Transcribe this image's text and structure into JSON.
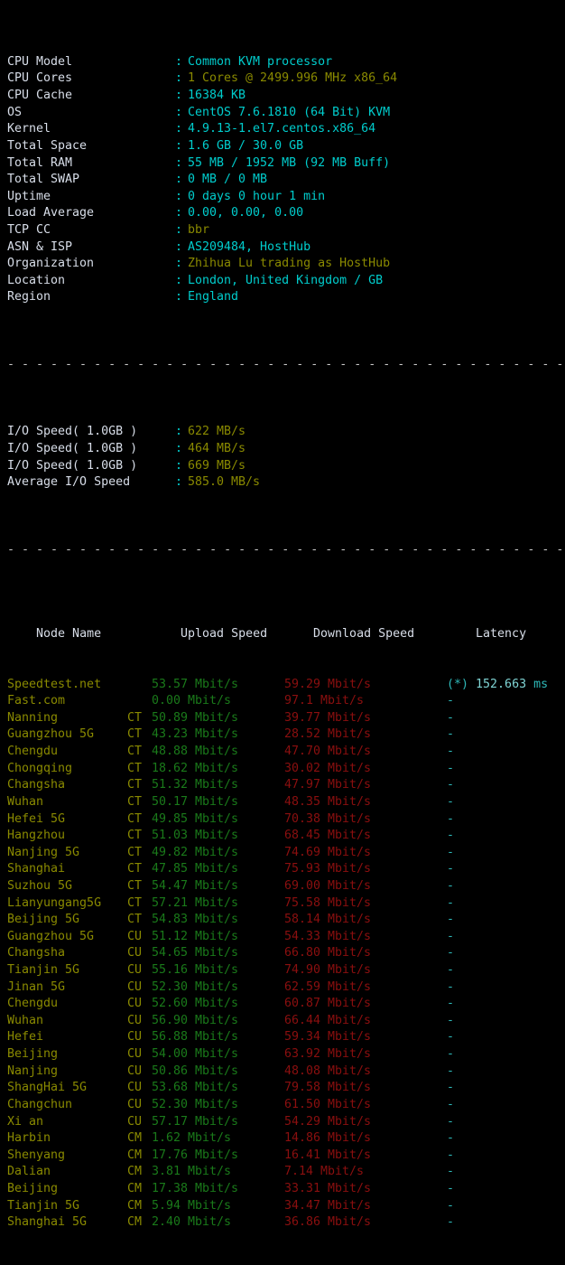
{
  "terminal": {
    "separator": "- - - - - - - - - - - - - - - - - - - - - - - - - - - - - - - - - - - - - - - - -",
    "sysinfo": [
      {
        "label": "CPU Model",
        "colon": ":",
        "value": "Common KVM processor",
        "color": "cyan"
      },
      {
        "label": "CPU Cores",
        "colon": ":",
        "value": "1 Cores @ 2499.996 MHz x86_64",
        "color": "yellow"
      },
      {
        "label": "CPU Cache",
        "colon": ":",
        "value": "16384 KB",
        "color": "cyan"
      },
      {
        "label": "OS",
        "colon": ":",
        "value": "CentOS 7.6.1810 (64 Bit) KVM",
        "color": "cyan"
      },
      {
        "label": "Kernel",
        "colon": ":",
        "value": "4.9.13-1.el7.centos.x86_64",
        "color": "cyan"
      },
      {
        "label": "Total Space",
        "colon": ":",
        "value": "1.6 GB / 30.0 GB",
        "color": "cyan"
      },
      {
        "label": "Total RAM",
        "colon": ":",
        "value": "55 MB / 1952 MB (92 MB Buff)",
        "color": "cyan"
      },
      {
        "label": "Total SWAP",
        "colon": ":",
        "value": "0 MB / 0 MB",
        "color": "cyan"
      },
      {
        "label": "Uptime",
        "colon": ":",
        "value": "0 days 0 hour 1 min",
        "color": "cyan"
      },
      {
        "label": "Load Average",
        "colon": ":",
        "value": "0.00, 0.00, 0.00",
        "color": "cyan"
      },
      {
        "label": "TCP CC",
        "colon": ":",
        "value": "bbr",
        "color": "yellow"
      },
      {
        "label": "ASN & ISP",
        "colon": ":",
        "value": "AS209484, HostHub",
        "color": "cyan"
      },
      {
        "label": "Organization",
        "colon": ":",
        "value": "Zhihua Lu trading as HostHub",
        "color": "yellow"
      },
      {
        "label": "Location",
        "colon": ":",
        "value": "London, United Kingdom / GB",
        "color": "cyan"
      },
      {
        "label": "Region",
        "colon": ":",
        "value": "England",
        "color": "cyan"
      }
    ],
    "iospeed": [
      {
        "label": "I/O Speed( 1.0GB )",
        "colon": ":",
        "value": "622 MB/s",
        "color": "yellow"
      },
      {
        "label": "I/O Speed( 1.0GB )",
        "colon": ":",
        "value": "464 MB/s",
        "color": "yellow"
      },
      {
        "label": "I/O Speed( 1.0GB )",
        "colon": ":",
        "value": "669 MB/s",
        "color": "yellow"
      },
      {
        "label": "Average I/O Speed",
        "colon": ":",
        "value": "585.0 MB/s",
        "color": "yellow"
      }
    ],
    "speedtest": {
      "headers": {
        "node": "Node Name",
        "upload": "Upload Speed",
        "download": "Download Speed",
        "latency": "Latency"
      },
      "rows": [
        {
          "node": "Speedtest.net",
          "isp": "",
          "upload": "53.57 Mbit/s",
          "download": "59.29 Mbit/s",
          "latency_star": "(*)",
          "latency_value": "152.663",
          "latency_unit": "ms"
        },
        {
          "node": "Fast.com",
          "isp": "",
          "upload": "0.00 Mbit/s",
          "download": "97.1 Mbit/s",
          "latency_star": "-",
          "latency_value": "",
          "latency_unit": ""
        },
        {
          "node": "Nanning",
          "isp": "CT",
          "upload": "50.89 Mbit/s",
          "download": "39.77 Mbit/s",
          "latency_star": "-",
          "latency_value": "",
          "latency_unit": ""
        },
        {
          "node": "Guangzhou 5G",
          "isp": "CT",
          "upload": "43.23 Mbit/s",
          "download": "28.52 Mbit/s",
          "latency_star": "-",
          "latency_value": "",
          "latency_unit": ""
        },
        {
          "node": "Chengdu",
          "isp": "CT",
          "upload": "48.88 Mbit/s",
          "download": "47.70 Mbit/s",
          "latency_star": "-",
          "latency_value": "",
          "latency_unit": ""
        },
        {
          "node": "Chongqing",
          "isp": "CT",
          "upload": "18.62 Mbit/s",
          "download": "30.02 Mbit/s",
          "latency_star": "-",
          "latency_value": "",
          "latency_unit": ""
        },
        {
          "node": "Changsha",
          "isp": "CT",
          "upload": "51.32 Mbit/s",
          "download": "47.97 Mbit/s",
          "latency_star": "-",
          "latency_value": "",
          "latency_unit": ""
        },
        {
          "node": "Wuhan",
          "isp": "CT",
          "upload": "50.17 Mbit/s",
          "download": "48.35 Mbit/s",
          "latency_star": "-",
          "latency_value": "",
          "latency_unit": ""
        },
        {
          "node": "Hefei 5G",
          "isp": "CT",
          "upload": "49.85 Mbit/s",
          "download": "70.38 Mbit/s",
          "latency_star": "-",
          "latency_value": "",
          "latency_unit": ""
        },
        {
          "node": "Hangzhou",
          "isp": "CT",
          "upload": "51.03 Mbit/s",
          "download": "68.45 Mbit/s",
          "latency_star": "-",
          "latency_value": "",
          "latency_unit": ""
        },
        {
          "node": "Nanjing 5G",
          "isp": "CT",
          "upload": "49.82 Mbit/s",
          "download": "74.69 Mbit/s",
          "latency_star": "-",
          "latency_value": "",
          "latency_unit": ""
        },
        {
          "node": "Shanghai",
          "isp": "CT",
          "upload": "47.85 Mbit/s",
          "download": "75.93 Mbit/s",
          "latency_star": "-",
          "latency_value": "",
          "latency_unit": ""
        },
        {
          "node": "Suzhou 5G",
          "isp": "CT",
          "upload": "54.47 Mbit/s",
          "download": "69.00 Mbit/s",
          "latency_star": "-",
          "latency_value": "",
          "latency_unit": ""
        },
        {
          "node": "Lianyungang5G",
          "isp": "CT",
          "upload": "57.21 Mbit/s",
          "download": "75.58 Mbit/s",
          "latency_star": "-",
          "latency_value": "",
          "latency_unit": ""
        },
        {
          "node": "Beijing 5G",
          "isp": "CT",
          "upload": "54.83 Mbit/s",
          "download": "58.14 Mbit/s",
          "latency_star": "-",
          "latency_value": "",
          "latency_unit": ""
        },
        {
          "node": "Guangzhou 5G",
          "isp": "CU",
          "upload": "51.12 Mbit/s",
          "download": "54.33 Mbit/s",
          "latency_star": "-",
          "latency_value": "",
          "latency_unit": ""
        },
        {
          "node": "Changsha",
          "isp": "CU",
          "upload": "54.65 Mbit/s",
          "download": "66.80 Mbit/s",
          "latency_star": "-",
          "latency_value": "",
          "latency_unit": ""
        },
        {
          "node": "Tianjin 5G",
          "isp": "CU",
          "upload": "55.16 Mbit/s",
          "download": "74.90 Mbit/s",
          "latency_star": "-",
          "latency_value": "",
          "latency_unit": ""
        },
        {
          "node": "Jinan 5G",
          "isp": "CU",
          "upload": "52.30 Mbit/s",
          "download": "62.59 Mbit/s",
          "latency_star": "-",
          "latency_value": "",
          "latency_unit": ""
        },
        {
          "node": "Chengdu",
          "isp": "CU",
          "upload": "52.60 Mbit/s",
          "download": "60.87 Mbit/s",
          "latency_star": "-",
          "latency_value": "",
          "latency_unit": ""
        },
        {
          "node": "Wuhan",
          "isp": "CU",
          "upload": "56.90 Mbit/s",
          "download": "66.44 Mbit/s",
          "latency_star": "-",
          "latency_value": "",
          "latency_unit": ""
        },
        {
          "node": "Hefei",
          "isp": "CU",
          "upload": "56.88 Mbit/s",
          "download": "59.34 Mbit/s",
          "latency_star": "-",
          "latency_value": "",
          "latency_unit": ""
        },
        {
          "node": "Beijing",
          "isp": "CU",
          "upload": "54.00 Mbit/s",
          "download": "63.92 Mbit/s",
          "latency_star": "-",
          "latency_value": "",
          "latency_unit": ""
        },
        {
          "node": "Nanjing",
          "isp": "CU",
          "upload": "50.86 Mbit/s",
          "download": "48.08 Mbit/s",
          "latency_star": "-",
          "latency_value": "",
          "latency_unit": ""
        },
        {
          "node": "ShangHai 5G",
          "isp": "CU",
          "upload": "53.68 Mbit/s",
          "download": "79.58 Mbit/s",
          "latency_star": "-",
          "latency_value": "",
          "latency_unit": ""
        },
        {
          "node": "Changchun",
          "isp": "CU",
          "upload": "52.30 Mbit/s",
          "download": "61.50 Mbit/s",
          "latency_star": "-",
          "latency_value": "",
          "latency_unit": ""
        },
        {
          "node": "Xi an",
          "isp": "CU",
          "upload": "57.17 Mbit/s",
          "download": "54.29 Mbit/s",
          "latency_star": "-",
          "latency_value": "",
          "latency_unit": ""
        },
        {
          "node": "Harbin",
          "isp": "CM",
          "upload": "1.62 Mbit/s",
          "download": "14.86 Mbit/s",
          "latency_star": "-",
          "latency_value": "",
          "latency_unit": ""
        },
        {
          "node": "Shenyang",
          "isp": "CM",
          "upload": "17.76 Mbit/s",
          "download": "16.41 Mbit/s",
          "latency_star": "-",
          "latency_value": "",
          "latency_unit": ""
        },
        {
          "node": "Dalian",
          "isp": "CM",
          "upload": "3.81 Mbit/s",
          "download": "7.14 Mbit/s",
          "latency_star": "-",
          "latency_value": "",
          "latency_unit": ""
        },
        {
          "node": "Beijing",
          "isp": "CM",
          "upload": "17.38 Mbit/s",
          "download": "33.31 Mbit/s",
          "latency_star": "-",
          "latency_value": "",
          "latency_unit": ""
        },
        {
          "node": "Tianjin 5G",
          "isp": "CM",
          "upload": "5.94 Mbit/s",
          "download": "34.47 Mbit/s",
          "latency_star": "-",
          "latency_value": "",
          "latency_unit": ""
        },
        {
          "node": "Shanghai 5G",
          "isp": "CM",
          "upload": "2.40 Mbit/s",
          "download": "36.86 Mbit/s",
          "latency_star": "-",
          "latency_value": "",
          "latency_unit": ""
        }
      ]
    },
    "colors": {
      "background": "#000000",
      "label": "#d8dee9",
      "cyan": "#00cdcd",
      "yellow": "#8a8a00",
      "green": "#1a7a1a",
      "red": "#8b0f0f",
      "separator": "#c8c8c8"
    }
  }
}
